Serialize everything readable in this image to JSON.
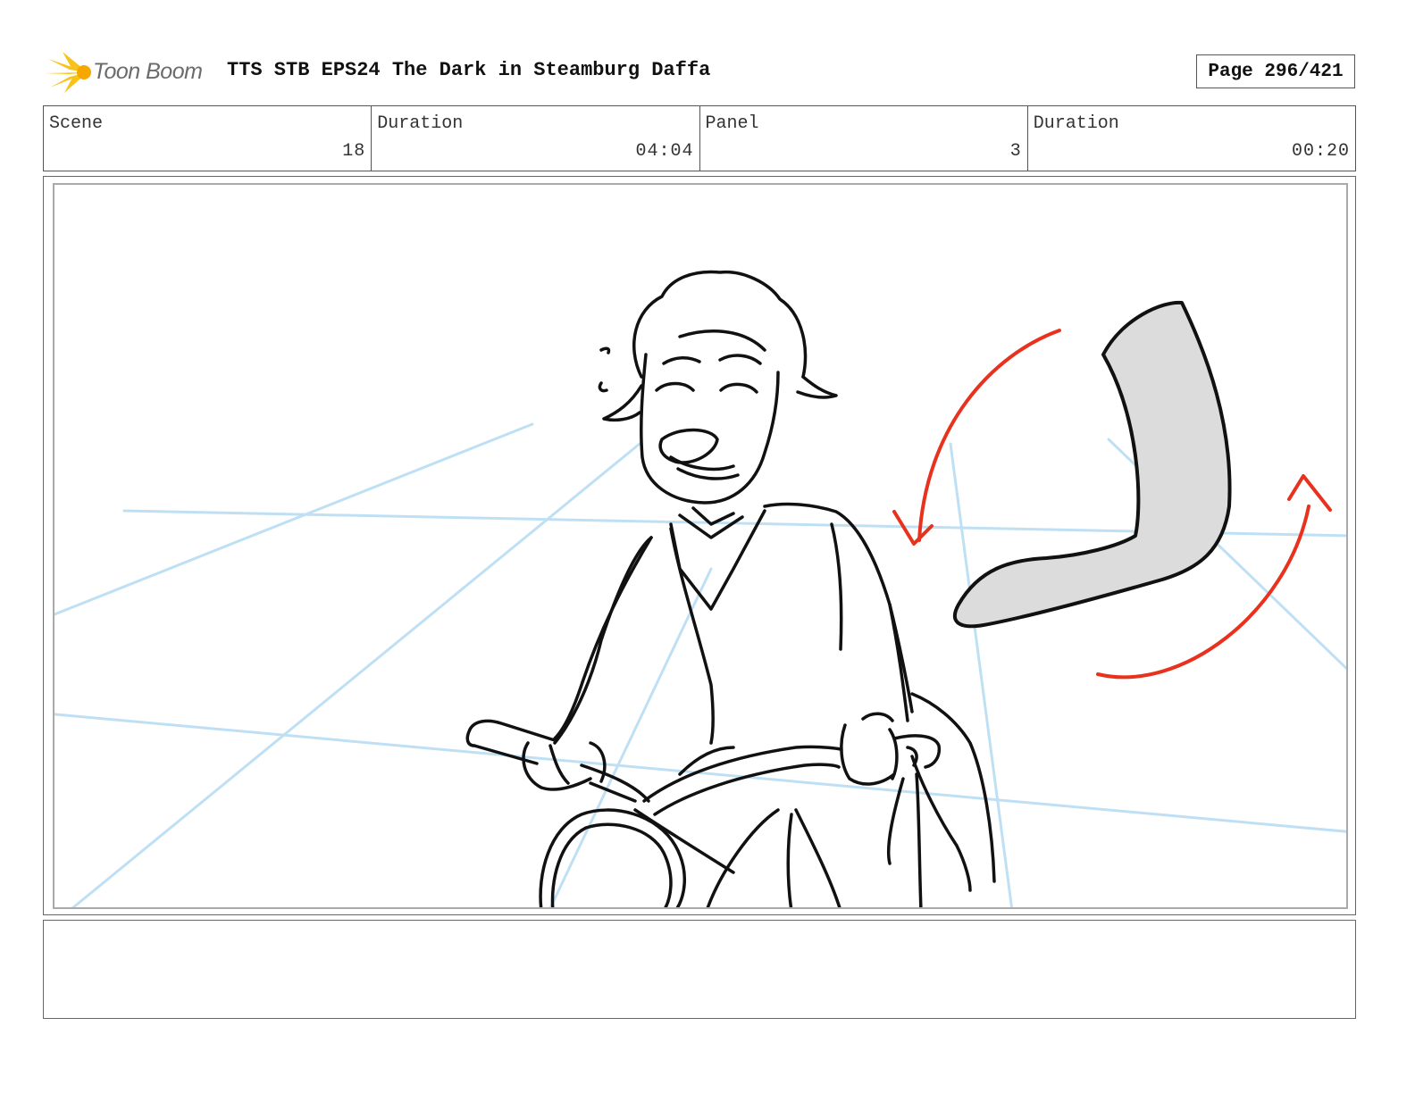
{
  "header": {
    "logo_text": "Toon Boom",
    "title": "TTS STB EPS24 The Dark in Steamburg Daffa",
    "page_label": "Page",
    "page_number": "296/421"
  },
  "info": [
    {
      "label": "Scene",
      "value": "18"
    },
    {
      "label": "Duration",
      "value": "04:04"
    },
    {
      "label": "Panel",
      "value": "3"
    },
    {
      "label": "Duration",
      "value": "00:20"
    }
  ],
  "colors": {
    "guide_lines": "#bfe0f4",
    "ink": "#111111",
    "motion_arrows": "#e8321e",
    "boomerang_fill": "#dcdcdc",
    "logo_yellow": "#f7c21a"
  },
  "icons": {
    "logo": "starburst-icon"
  },
  "notes": {
    "text": ""
  }
}
